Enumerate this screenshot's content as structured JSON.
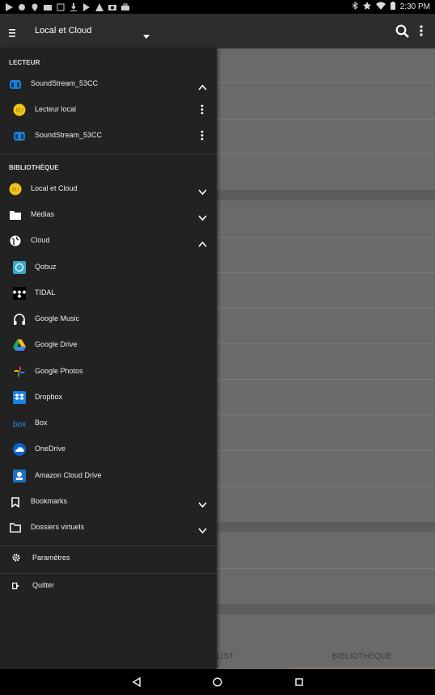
{
  "status": {
    "time": "2:30 PM"
  },
  "appbar": {
    "title": "Local et Cloud"
  },
  "drawer": {
    "section_player": "LECTEUR",
    "player_device": "SoundStream_53CC",
    "player_local": "Lecteur local",
    "player_stream": "SoundStream_53CC",
    "section_library": "BIBLIOTHÈQUE",
    "local_cloud": "Local et Cloud",
    "medias": "Médias",
    "cloud": "Cloud",
    "cloud_items": [
      "Qobuz",
      "TIDAL",
      "Google Music",
      "Google Drive",
      "Google Photos",
      "Dropbox",
      "Box",
      "OneDrive",
      "Amazon Cloud Drive"
    ],
    "bookmarks": "Bookmarks",
    "virtual_folders": "Dossiers virtuels",
    "settings": "Paramètres",
    "quit": "Quitter"
  },
  "tabs": {
    "left": "LIST",
    "right": "BIBLIOTHÈQUE"
  },
  "colors": {
    "accent": "#f0c419",
    "drawer_bg": "#222222",
    "appbar_bg": "#2d2d2d"
  }
}
